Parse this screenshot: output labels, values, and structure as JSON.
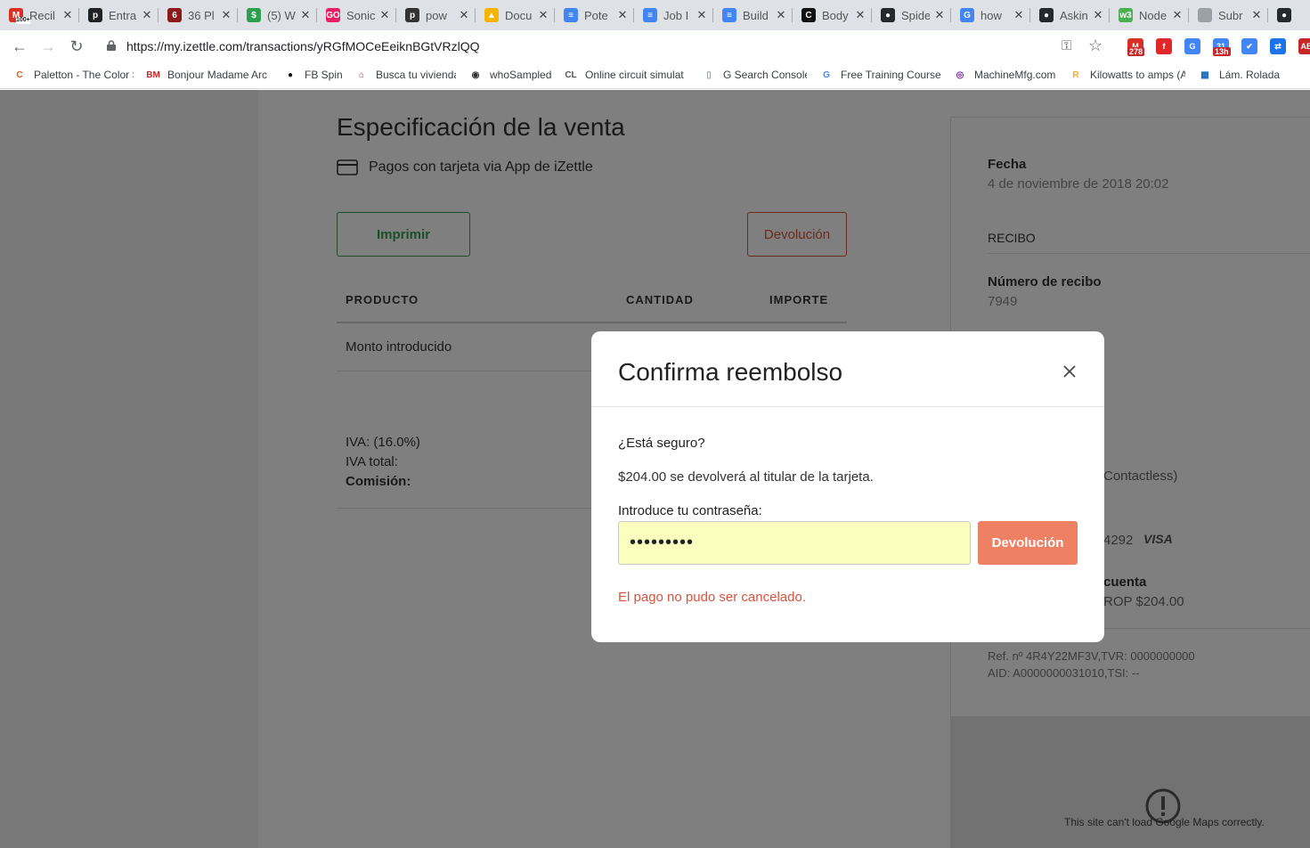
{
  "browser": {
    "tabs": [
      {
        "title": "Recil",
        "icon": "gmail-icon",
        "color": "#d93025",
        "glyph": "M",
        "badge": "100+"
      },
      {
        "title": "Entra",
        "icon": "p-icon",
        "color": "#222222",
        "glyph": "p"
      },
      {
        "title": "36 Pl",
        "icon": "six-icon",
        "color": "#8b1a1a",
        "glyph": "6"
      },
      {
        "title": "(5) W",
        "icon": "dollar-icon",
        "color": "#2e9e4f",
        "glyph": "$"
      },
      {
        "title": "Sonic",
        "icon": "go-icon",
        "color": "#e91e63",
        "glyph": "GO"
      },
      {
        "title": "pow",
        "icon": "p-icon",
        "color": "#333333",
        "glyph": "p"
      },
      {
        "title": "Docu",
        "icon": "drive-icon",
        "color": "#f4b400",
        "glyph": "▲"
      },
      {
        "title": "Pote",
        "icon": "docs-icon",
        "color": "#4285f4",
        "glyph": "≡"
      },
      {
        "title": "Job I",
        "icon": "docs-icon",
        "color": "#4285f4",
        "glyph": "≡"
      },
      {
        "title": "Build",
        "icon": "docs-icon",
        "color": "#4285f4",
        "glyph": "≡"
      },
      {
        "title": "Body",
        "icon": "c-icon",
        "color": "#111111",
        "glyph": "C"
      },
      {
        "title": "Spide",
        "icon": "github-icon",
        "color": "#24292e",
        "glyph": "●"
      },
      {
        "title": "how",
        "icon": "google-icon",
        "color": "#4285f4",
        "glyph": "G"
      },
      {
        "title": "Askin",
        "icon": "github-icon",
        "color": "#24292e",
        "glyph": "●"
      },
      {
        "title": "Node",
        "icon": "w3-icon",
        "color": "#4caf50",
        "glyph": "w3"
      },
      {
        "title": "Subr",
        "icon": "page-icon",
        "color": "#9aa0a6",
        "glyph": ""
      },
      {
        "title": "",
        "icon": "github-icon",
        "color": "#24292e",
        "glyph": "●"
      }
    ],
    "url": "https://my.izettle.com/transactions/yRGfMOCeEeiknBGtVRzlQQ",
    "extensions": [
      {
        "icon": "gmail-ext-icon",
        "color": "#d93025",
        "glyph": "M",
        "badge": "278"
      },
      {
        "icon": "flipboard-icon",
        "color": "#e12828",
        "glyph": "f"
      },
      {
        "icon": "translate-icon",
        "color": "#4285f4",
        "glyph": "G"
      },
      {
        "icon": "calendar-icon",
        "color": "#4285f4",
        "glyph": "31",
        "badge": "13h"
      },
      {
        "icon": "check-icon",
        "color": "#4285f4",
        "glyph": "✔"
      },
      {
        "icon": "ext-blue-icon",
        "color": "#1a73e8",
        "glyph": "⇄"
      },
      {
        "icon": "adblock-icon",
        "color": "#c62828",
        "glyph": "AB"
      }
    ],
    "bookmarks": [
      {
        "title": "Paletton - The Color S",
        "icon": "paletton-icon",
        "color": "#e8531f",
        "glyph": "C"
      },
      {
        "title": "Bonjour Madame Arc",
        "icon": "bm-icon",
        "color": "#c62828",
        "glyph": "BM"
      },
      {
        "title": "FB Spin",
        "icon": "fbspin-icon",
        "color": "#111111",
        "glyph": "●"
      },
      {
        "title": "Busca tu vivienda",
        "icon": "house-icon",
        "color": "#c62828",
        "glyph": "⌂"
      },
      {
        "title": "whoSampled",
        "icon": "whosampled-icon",
        "color": "#333333",
        "glyph": "◉"
      },
      {
        "title": "Online circuit simulat",
        "icon": "circuit-icon",
        "color": "#555555",
        "glyph": "CL"
      },
      {
        "title": "G Search Console",
        "icon": "page-icon",
        "color": "#9aa0a6",
        "glyph": "▯"
      },
      {
        "title": "Free Training Course",
        "icon": "google-icon",
        "color": "#4285f4",
        "glyph": "G"
      },
      {
        "title": "MachineMfg.com",
        "icon": "machinemfg-icon",
        "color": "#7b1fa2",
        "glyph": "◎"
      },
      {
        "title": "Kilowatts to amps (A)",
        "icon": "r-icon",
        "color": "#f9a825",
        "glyph": "R"
      },
      {
        "title": "Lám. Rolada Fr",
        "icon": "rolada-icon",
        "color": "#1565c0",
        "glyph": "▦"
      }
    ]
  },
  "page": {
    "title": "Especificación de la venta",
    "payment_type": "Pagos con tarjeta via App de iZettle",
    "print_label": "Imprimir",
    "refund_label": "Devolución",
    "table": {
      "columns": [
        "PRODUCTO",
        "CANTIDAD",
        "IMPORTE"
      ],
      "rows": [
        [
          "Monto introducido"
        ]
      ]
    },
    "totals": {
      "iva_rate": "IVA: (16.0%)",
      "iva_total": "IVA total:",
      "commission": "Comisión:"
    },
    "side": {
      "date_label": "Fecha",
      "date_value": "4 de noviembre de 2018 20:02",
      "receipt_header": "RECIBO",
      "receipt_number_label": "Número de recibo",
      "receipt_number": "7949",
      "contactless": "Contactless)",
      "card_last4": "4292",
      "card_brand": "VISA",
      "account_label": "cuenta",
      "account_value": "ROP $204.00",
      "ref_line": "Ref. nº 4R4Y22MF3V,TVR: 0000000000",
      "aid_line": "AID: A0000000031010,TSI: --",
      "map_error": "This site can't load Google Maps correctly."
    }
  },
  "modal": {
    "title": "Confirma reembolso",
    "question": "¿Está seguro?",
    "description": "$204.00 se devolverá al titular de la tarjeta.",
    "password_label": "Introduce tu contraseña:",
    "password_value": "•••••••••",
    "submit_label": "Devolución",
    "error": "El pago no pudo ser cancelado.",
    "accent_color": "#ee8064",
    "error_color": "#d8523c"
  }
}
